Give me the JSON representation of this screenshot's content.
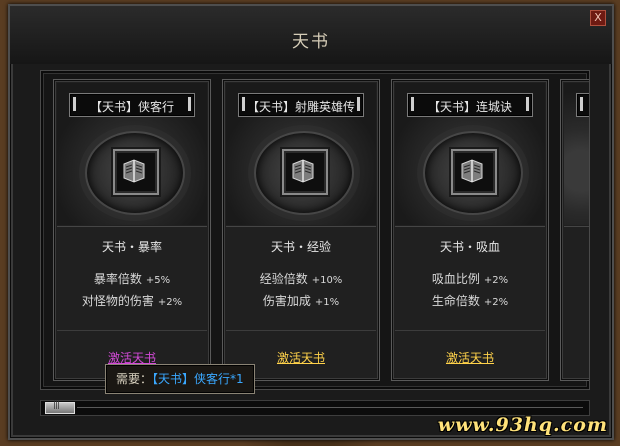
{
  "window": {
    "title": "天书",
    "close_label": "X"
  },
  "cards": [
    {
      "title": "【天书】侠客行",
      "skill": "天书・暴率",
      "stats": [
        {
          "label": "暴率倍数",
          "value": "+5%"
        },
        {
          "label": "对怪物的伤害",
          "value": "+2%"
        }
      ],
      "action": "激活天书"
    },
    {
      "title": "【天书】射雕英雄传",
      "skill": "天书・经验",
      "stats": [
        {
          "label": "经验倍数",
          "value": "+10%"
        },
        {
          "label": "伤害加成",
          "value": "+1%"
        }
      ],
      "action": "激活天书"
    },
    {
      "title": "【天书】连城诀",
      "skill": "天书・吸血",
      "stats": [
        {
          "label": "吸血比例",
          "value": "+2%"
        },
        {
          "label": "生命倍数",
          "value": "+2%"
        }
      ],
      "action": "激活天书"
    },
    {
      "title": "【"
    }
  ],
  "tooltip": {
    "prefix": "需要：",
    "item": "【天书】侠客行*1"
  },
  "watermark": "www.93hq.com",
  "colors": {
    "activate_hover": "#d34ad8",
    "activate": "#ffd24a",
    "tooltip_item": "#3aa8ff",
    "watermark": "#ffe27a"
  },
  "icons": {
    "book": "scroll-book-icon",
    "close": "close-icon"
  }
}
